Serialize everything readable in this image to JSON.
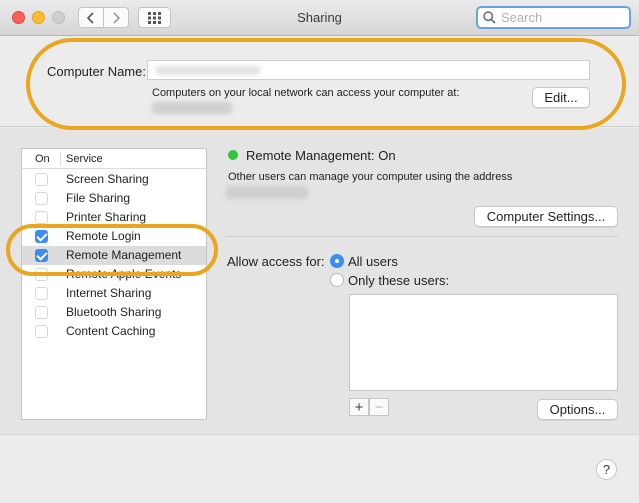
{
  "window": {
    "title": "Sharing"
  },
  "search": {
    "placeholder": "Search"
  },
  "computer_name": {
    "label": "Computer Name:",
    "description": "Computers on your local network can access your computer at:",
    "edit_label": "Edit..."
  },
  "services": {
    "col_on": "On",
    "col_service": "Service",
    "items": [
      {
        "label": "Screen Sharing",
        "checked": false,
        "selected": false
      },
      {
        "label": "File Sharing",
        "checked": false,
        "selected": false
      },
      {
        "label": "Printer Sharing",
        "checked": false,
        "selected": false
      },
      {
        "label": "Remote Login",
        "checked": true,
        "selected": false
      },
      {
        "label": "Remote Management",
        "checked": true,
        "selected": true
      },
      {
        "label": "Remote Apple Events",
        "checked": false,
        "selected": false
      },
      {
        "label": "Internet Sharing",
        "checked": false,
        "selected": false
      },
      {
        "label": "Bluetooth Sharing",
        "checked": false,
        "selected": false
      },
      {
        "label": "Content Caching",
        "checked": false,
        "selected": false
      }
    ]
  },
  "detail": {
    "status": "Remote Management: On",
    "status_color": "#2fc53e",
    "description": "Other users can manage your computer using the address",
    "settings_label": "Computer Settings...",
    "access_label": "Allow access for:",
    "all_users": "All users",
    "only_users": "Only these users:",
    "options_label": "Options..."
  },
  "help": {
    "label": "?"
  },
  "colors": {
    "accent": "#3d8cf0",
    "highlight": "#e9a61e"
  }
}
